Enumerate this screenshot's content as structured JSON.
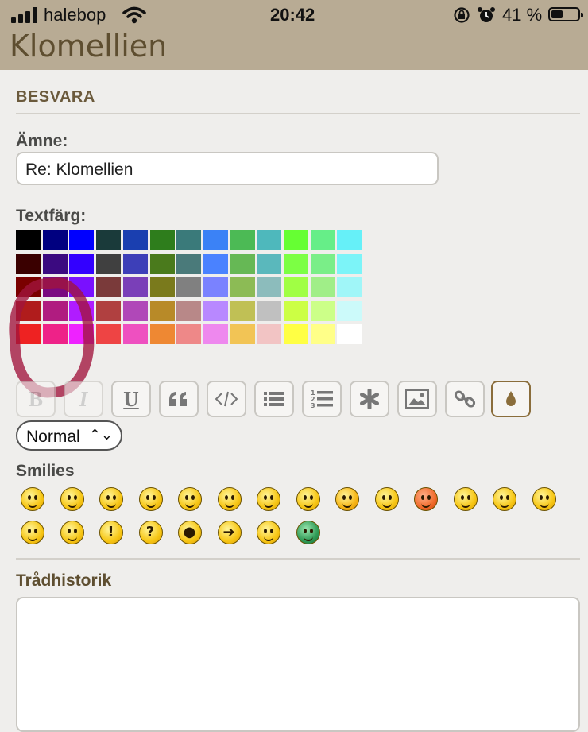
{
  "status_bar": {
    "carrier": "halebop",
    "time": "20:42",
    "battery_percent": "41 %"
  },
  "app": {
    "title": "Klomellien"
  },
  "reply": {
    "section_title": "BESVARA",
    "subject_label": "Ämne:",
    "subject_value": "Re: Klomellien",
    "text_color_label": "Textfärg:"
  },
  "palette": [
    [
      "#000000",
      "#000080",
      "#0000ff",
      "#1a3a3a",
      "#1a3fb0",
      "#2e7d1c",
      "#3a7a7a",
      "#3b82f6",
      "#4cba55",
      "#4eb8bc",
      "#66ff33",
      "#66ee88",
      "#66f0f8"
    ],
    [
      "#3a0000",
      "#3b0a80",
      "#3300ff",
      "#404040",
      "#3d3fb8",
      "#4a7a1c",
      "#4a7a7a",
      "#4a82ff",
      "#66b855",
      "#5ab8bc",
      "#7cff44",
      "#7aee88",
      "#7cf4f8"
    ],
    [
      "#7a0000",
      "#7a0a80",
      "#7a10ff",
      "#7a3a3a",
      "#7a3fb8",
      "#7a7a1c",
      "#808080",
      "#7a82ff",
      "#8cbb55",
      "#8cbcbc",
      "#a0ff44",
      "#a0ee88",
      "#a0f6f8"
    ],
    [
      "#b01c1c",
      "#b01c80",
      "#b01cff",
      "#b04040",
      "#b048b8",
      "#b88a28",
      "#b88888",
      "#b888ff",
      "#c0c055",
      "#c0c0c0",
      "#ccff44",
      "#ccff88",
      "#ccfafa"
    ],
    [
      "#ee2222",
      "#ee2288",
      "#ee22ff",
      "#ee4444",
      "#ee50c0",
      "#ee8833",
      "#ee8888",
      "#ee88ee",
      "#f2c455",
      "#f2c4c4",
      "#ffff44",
      "#ffff88",
      "#ffffff"
    ]
  ],
  "toolbar": {
    "buttons": [
      {
        "label": "B",
        "icon": "bold-icon"
      },
      {
        "label": "I",
        "icon": "italic-icon"
      },
      {
        "label": "U",
        "icon": "underline-icon"
      },
      {
        "label": "",
        "icon": "quote-icon"
      },
      {
        "label": "",
        "icon": "code-icon"
      },
      {
        "label": "",
        "icon": "bullet-list-icon"
      },
      {
        "label": "",
        "icon": "numbered-list-icon"
      },
      {
        "label": "",
        "icon": "asterisk-icon"
      },
      {
        "label": "",
        "icon": "image-icon"
      },
      {
        "label": "",
        "icon": "link-icon"
      },
      {
        "label": "",
        "icon": "color-drop-icon"
      }
    ],
    "size_selected": "Normal"
  },
  "smilies": {
    "label": "Smilies",
    "row1": [
      "grin",
      "smile",
      "sad",
      "surprised",
      "glasses",
      "confused",
      "cool",
      "laughing",
      "mad",
      "tongue",
      "red-face",
      "nerd",
      "evil",
      "twisted-evil"
    ],
    "row2": [
      "rolling-eyes",
      "wink",
      "exclamation",
      "question",
      "idea",
      "arrow",
      "neutral",
      "green-grin"
    ]
  },
  "thread_history": {
    "label": "Trådhistorik"
  }
}
